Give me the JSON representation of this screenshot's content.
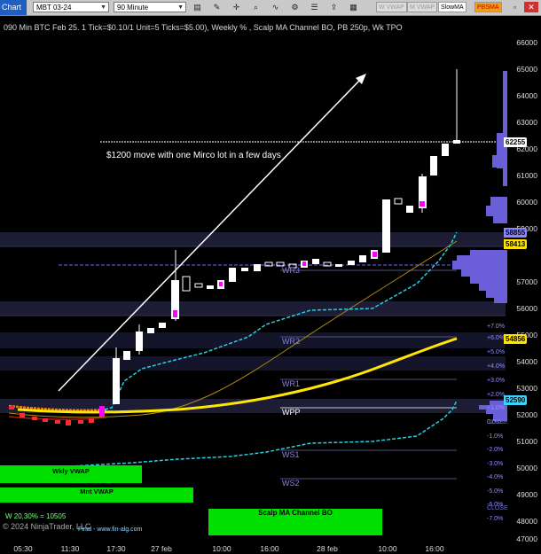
{
  "toolbar": {
    "chart_tab": "Chart",
    "instrument": "MBT 03-24",
    "interval": "90 Minute",
    "icons": [
      "chart-style-icon",
      "draw-icon",
      "crosshair-icon",
      "zoom-icon",
      "indicators-icon",
      "strategies-icon",
      "properties-icon",
      "share-icon",
      "tile-icon"
    ],
    "toggles": [
      {
        "label": "W VWAP",
        "state": "off"
      },
      {
        "label": "M VWAP",
        "state": "off"
      },
      {
        "label": "SlowMA",
        "state": "on"
      },
      {
        "label": "PBSMA",
        "state": "hot"
      }
    ]
  },
  "subtitle": "090 Min BTC Feb 25. 1 Tick=$0.10/1 Unit=5 Ticks=$5.00), Weekly % , Scalp MA Channel BO, PB 250p, Wk TPO",
  "annotation": "$1200 move with one Mirco lot in a few days",
  "price_axis": {
    "ticks": [
      "66000",
      "65000",
      "64000",
      "63000",
      "62000",
      "61000",
      "60000",
      "59000",
      "57000",
      "56000",
      "55000",
      "54000",
      "53000",
      "52000",
      "51000",
      "50000",
      "49000",
      "48000",
      "47000"
    ],
    "labels": [
      {
        "text": "62255",
        "bg": "#ffffff",
        "fg": "#000000"
      },
      {
        "text": "58855",
        "bg": "#8c86ff",
        "fg": "#000000"
      },
      {
        "text": "58413",
        "bg": "#ffe300",
        "fg": "#000000"
      },
      {
        "text": "54856",
        "bg": "#ffe300",
        "fg": "#000000"
      },
      {
        "text": "52590",
        "bg": "#3ad4ff",
        "fg": "#000000"
      }
    ]
  },
  "time_axis": [
    "05:30",
    "11:30",
    "17:30",
    "27 feb",
    "10:00",
    "16:00",
    "28 feb",
    "10:00",
    "16:00"
  ],
  "levels": [
    "WR3",
    "WR2",
    "WR1",
    "WPP",
    "WS1",
    "WS2"
  ],
  "percents": [
    "+7.0%",
    "+6.0%",
    "+5.0%",
    "+4.0%",
    "+3.0%",
    "+2.0%",
    "+1.0%",
    "0.0%",
    "-1.0%",
    "-2.0%",
    "-3.0%",
    "-4.0%",
    "-5.0%",
    "-6.0%",
    "-7.0%",
    "CLOSE",
    "CLOSE"
  ],
  "boxes": {
    "wkly_vwap": "Wkly VWAP",
    "mnt_vwap": "Mnt VWAP",
    "scalp": "Scalp MA Channel BO"
  },
  "w_label": "W 20,30% = 10505",
  "copyright": "© 2024 NinjaTrader, LLC",
  "website": "Final - www.fin-alg.com",
  "colors": {
    "background": "#000000",
    "up_candle": "#ffffff",
    "marker": "#ff00ff",
    "cyan_line": "#22d3e6",
    "yellow_ma": "#ffe600",
    "thin_ma": "#b08a10",
    "vwap_orange": "#e08020",
    "profile": "#6a5fd8",
    "level_text": "#8a7cff",
    "green_box": "#00e000"
  }
}
